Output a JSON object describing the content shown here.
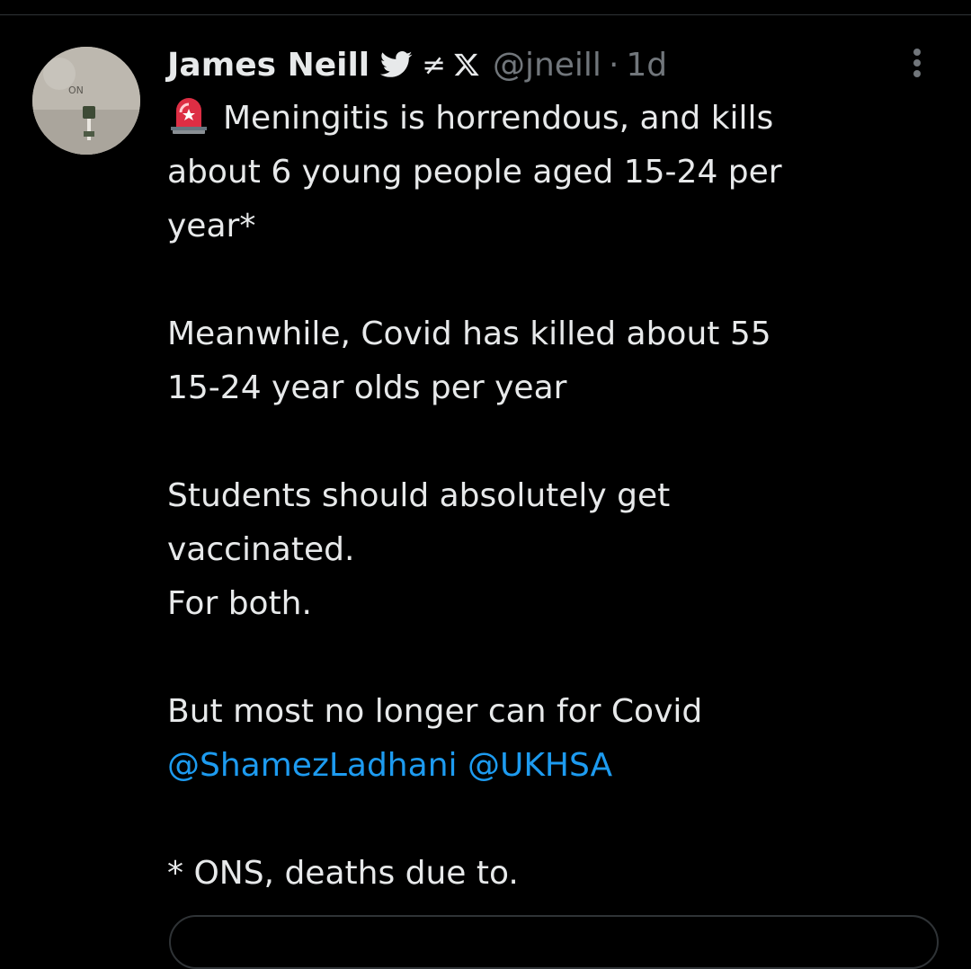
{
  "tweet": {
    "author_name": "James Neill",
    "neq_symbol": "≠",
    "handle": "@jneill",
    "separator": "·",
    "timestamp": "1d",
    "lines": {
      "l1": "Meningitis is horrendous, and kills",
      "l2": "about 6 young people aged 15-24 per",
      "l3": "year*",
      "l4": "Meanwhile, Covid has killed about 55",
      "l5": "15-24 year olds per year",
      "l6": "Students should absolutely get",
      "l7": "vaccinated.",
      "l8": "For both.",
      "l9": "But most no longer can for Covid",
      "l11": "* ONS, deaths due to."
    },
    "mentions": [
      "@ShamezLadhani",
      "@UKHSA"
    ],
    "avatar_text": "ON"
  },
  "icons": {
    "siren": "police-car-light-emoji",
    "bird": "twitter-bird-icon",
    "x": "x-logo-icon",
    "more": "more-options-icon"
  },
  "colors": {
    "background": "#000000",
    "text": "#e7e9ea",
    "muted": "#71767b",
    "link": "#1d9bf0",
    "divider": "#2f3336"
  }
}
